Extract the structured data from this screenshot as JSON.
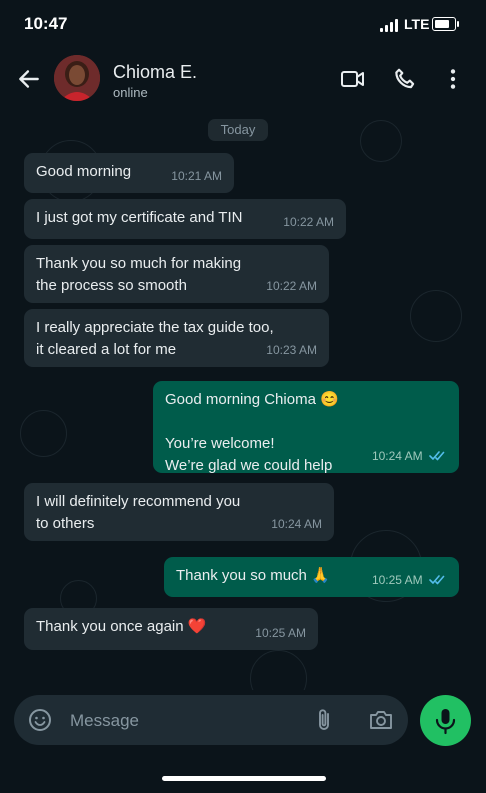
{
  "status_bar": {
    "time": "10:47",
    "network": "LTE"
  },
  "header": {
    "contact_name": "Chioma E.",
    "contact_status": "online",
    "icons": [
      "back-arrow-icon",
      "video-call-icon",
      "voice-call-icon",
      "more-options-icon"
    ]
  },
  "date_chip": "Today",
  "messages": [
    {
      "direction": "incoming",
      "text": "Good morning",
      "time": "10:21 AM"
    },
    {
      "direction": "incoming",
      "text": "I just got my certificate and TIN",
      "time": "10:22 AM"
    },
    {
      "direction": "incoming",
      "text": "Thank you so much for making\nthe process so smooth",
      "time": "10:22 AM"
    },
    {
      "direction": "incoming",
      "text": "I really appreciate the tax guide too,\nit cleared a lot for me",
      "time": "10:23 AM"
    },
    {
      "direction": "outgoing",
      "text": "Good morning Chioma 😊\n\nYou’re welcome!\nWe’re glad we could help",
      "time": "10:24 AM",
      "status": "read"
    },
    {
      "direction": "incoming",
      "text": "I will definitely recommend you\nto others",
      "time": "10:24 AM"
    },
    {
      "direction": "outgoing",
      "text": "Thank you so much 🙏",
      "time": "10:25 AM",
      "status": "read"
    },
    {
      "direction": "incoming",
      "text": "Thank you once again ❤️",
      "time": "10:25 AM"
    }
  ],
  "composer": {
    "placeholder": "Message",
    "icons": [
      "emoji-icon",
      "attach-icon",
      "camera-icon",
      "microphone-icon"
    ]
  },
  "colors": {
    "background": "#0b141a",
    "incoming_bubble": "#202c33",
    "outgoing_bubble": "#005c4b",
    "read_ticks": "#53bdeb",
    "mic_button": "#21c063"
  }
}
